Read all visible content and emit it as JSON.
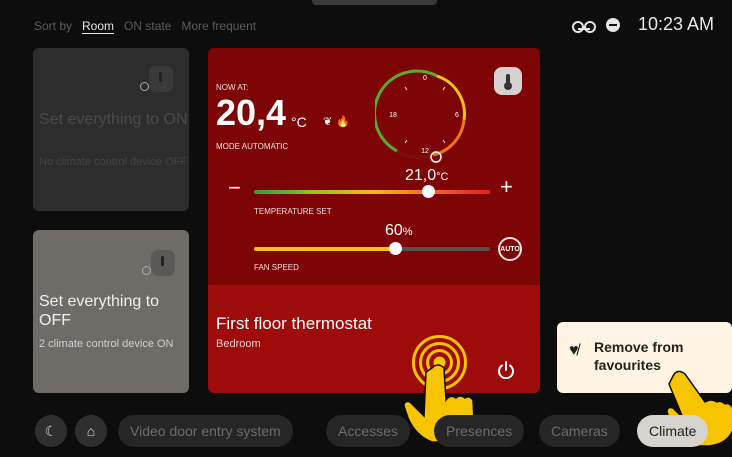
{
  "sort_bar": {
    "label": "Sort by",
    "options": [
      "Room",
      "ON state",
      "More frequent"
    ],
    "active": "Room"
  },
  "status": {
    "time": "10:23 AM",
    "icons": [
      "voicemail-icon",
      "do-not-disturb-icon"
    ]
  },
  "cards": {
    "on": {
      "title": "Set everything to ON",
      "subtitle": "No climate control device OFF"
    },
    "off": {
      "title": "Set everything to OFF",
      "subtitle": "2 climate control device ON"
    }
  },
  "thermostat": {
    "now_at_label": "NOW AT:",
    "current_temp": "20,4",
    "current_unit": "°C",
    "mode_label": "MODE AUTOMATIC",
    "dial_labels": [
      "0",
      "6",
      "12",
      "18"
    ],
    "temp_set_value": "21,0",
    "temp_set_unit": "°C",
    "temp_set_label": "TEMPERATURE SET",
    "temp_set_fraction": 0.74,
    "minus_label": "−",
    "plus_label": "+",
    "fan_value": "60",
    "fan_unit": "%",
    "fan_label": "FAN SPEED",
    "fan_fraction": 0.6,
    "auto_label": "AUTO",
    "device_name": "First floor thermostat",
    "room": "Bedroom"
  },
  "toast": {
    "message": "Remove from favourites"
  },
  "bottom_nav": {
    "items": [
      "Video door entry system",
      "Accesses",
      "Presences",
      "Cameras",
      "Climate"
    ],
    "active": "Climate"
  },
  "colors": {
    "card_red": "#7d0505",
    "card_red_bottom": "#9d0b0b",
    "accent_yellow": "#f4c21a",
    "toast_bg": "#fff4e4"
  }
}
